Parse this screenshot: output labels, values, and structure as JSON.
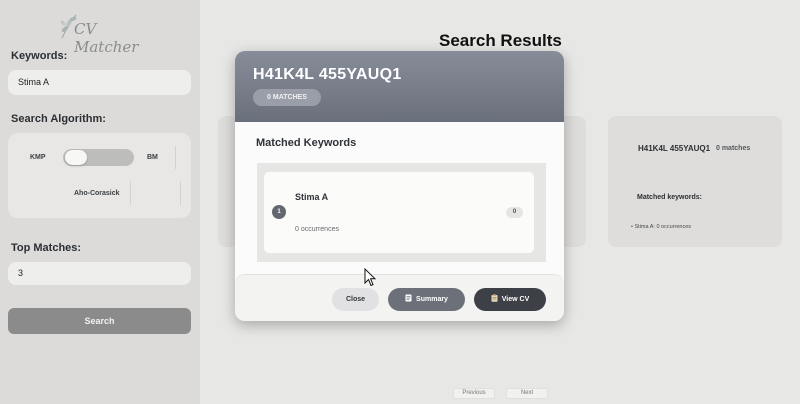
{
  "sidebar": {
    "logo_text": "CV Matcher",
    "keywords_label": "Keywords:",
    "keywords_value": "Stima A",
    "algorithm_label": "Search Algorithm:",
    "algorithm_options": {
      "kmp": "KMP",
      "bm": "BM",
      "aho": "Aho-Corasick"
    },
    "algorithm_toggle_selected": "KMP",
    "top_matches_label": "Top Matches:",
    "top_matches_value": "3",
    "search_button": "Search"
  },
  "main": {
    "title": "Search Results",
    "result_card": {
      "name": "H41K4L 455YAUQ1",
      "matches": "0 matches",
      "matched_label": "Matched keywords:",
      "matched_item": "• Stima A: 0 occurrences"
    },
    "pagination": {
      "previous": "Previous",
      "next": "Next"
    }
  },
  "modal": {
    "title": "H41K4L 455YAUQ1",
    "matches_pill": "0 MATCHES",
    "section_heading": "Matched Keywords",
    "keywords": [
      {
        "index": "1",
        "name": "Stima A",
        "occurrences": "0 occurrences",
        "count": "0"
      }
    ],
    "buttons": {
      "close": "Close",
      "summary": "Summary",
      "view_cv": "View CV"
    }
  },
  "colors": {
    "sidebar_bg": "#dcdbd9",
    "modal_header": "#787d89",
    "search_button": "#8b8b8b",
    "view_cv_button": "#3d4046"
  }
}
